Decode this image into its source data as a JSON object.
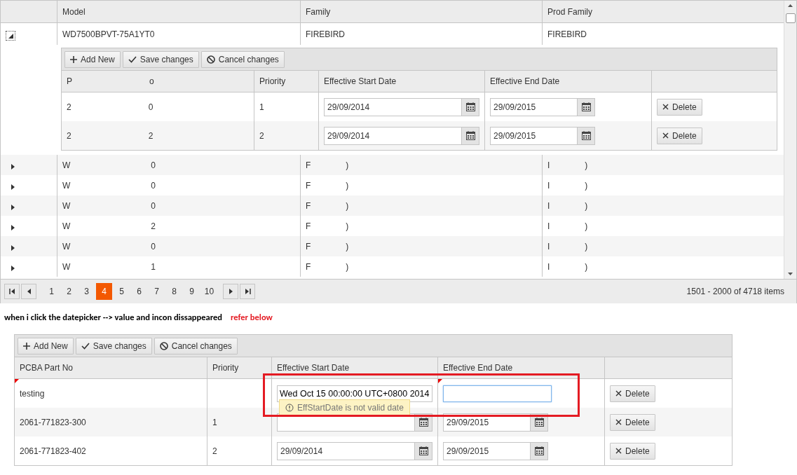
{
  "master_grid": {
    "columns": [
      {
        "label": "Model"
      },
      {
        "label": "Family"
      },
      {
        "label": "Prod Family"
      }
    ],
    "rows": [
      {
        "expanded": true,
        "cells": [
          {
            "kind": "text",
            "text": "WD7500BPVT-75A1YT0"
          },
          {
            "kind": "text",
            "text": "FIREBIRD"
          },
          {
            "kind": "text",
            "text": "FIREBIRD"
          }
        ],
        "detail": {
          "toolbar": [
            {
              "kind": "add",
              "label": "Add New"
            },
            {
              "kind": "save",
              "label": "Save changes"
            },
            {
              "kind": "cancel",
              "label": "Cancel changes"
            }
          ],
          "columns": [
            {
              "kind": "redacted",
              "start": "P",
              "end": "o"
            },
            {
              "kind": "text",
              "text": "Priority"
            },
            {
              "kind": "text",
              "text": "Effective Start Date"
            },
            {
              "kind": "text",
              "text": "Effective End Date"
            },
            {
              "kind": "empty"
            }
          ],
          "rows": [
            {
              "cells": [
                {
                  "kind": "redacted",
                  "start": "2",
                  "end": "0"
                },
                {
                  "kind": "text",
                  "text": "1"
                },
                {
                  "kind": "date",
                  "value": "29/09/2014"
                },
                {
                  "kind": "date",
                  "value": "29/09/2015"
                },
                {
                  "kind": "delete",
                  "label": "Delete"
                }
              ]
            },
            {
              "cells": [
                {
                  "kind": "redacted",
                  "start": "2",
                  "end": "2"
                },
                {
                  "kind": "text",
                  "text": "2"
                },
                {
                  "kind": "date",
                  "value": "29/09/2014"
                },
                {
                  "kind": "date",
                  "value": "29/09/2015"
                },
                {
                  "kind": "delete",
                  "label": "Delete"
                }
              ]
            }
          ]
        }
      },
      {
        "expanded": false,
        "cells": [
          {
            "kind": "redacted",
            "start": "W",
            "end": "0"
          },
          {
            "kind": "redacted",
            "start": "F",
            "end": ")"
          },
          {
            "kind": "redacted",
            "start": "I",
            "end": ")"
          }
        ]
      },
      {
        "expanded": false,
        "cells": [
          {
            "kind": "redacted",
            "start": "W",
            "end": "0"
          },
          {
            "kind": "redacted",
            "start": "F",
            "end": ")"
          },
          {
            "kind": "redacted",
            "start": "I",
            "end": ")"
          }
        ]
      },
      {
        "expanded": false,
        "cells": [
          {
            "kind": "redacted",
            "start": "W",
            "end": "0"
          },
          {
            "kind": "redacted",
            "start": "F",
            "end": ")"
          },
          {
            "kind": "redacted",
            "start": "I",
            "end": ")"
          }
        ]
      },
      {
        "expanded": false,
        "cells": [
          {
            "kind": "redacted",
            "start": "W",
            "end": "2"
          },
          {
            "kind": "redacted",
            "start": "F",
            "end": ")"
          },
          {
            "kind": "redacted",
            "start": "I",
            "end": ")"
          }
        ]
      },
      {
        "expanded": false,
        "cells": [
          {
            "kind": "redacted",
            "start": "W",
            "end": "0"
          },
          {
            "kind": "redacted",
            "start": "F",
            "end": ")"
          },
          {
            "kind": "redacted",
            "start": "I",
            "end": ")"
          }
        ]
      },
      {
        "expanded": false,
        "cells": [
          {
            "kind": "redacted",
            "start": "W",
            "end": "1"
          },
          {
            "kind": "redacted",
            "start": "F",
            "end": ")"
          },
          {
            "kind": "redacted",
            "start": "I",
            "end": ")"
          }
        ]
      }
    ],
    "pager": {
      "pages": [
        {
          "label": "1",
          "selected": false
        },
        {
          "label": "2",
          "selected": false
        },
        {
          "label": "3",
          "selected": false
        },
        {
          "label": "4",
          "selected": true
        },
        {
          "label": "5",
          "selected": false
        },
        {
          "label": "6",
          "selected": false
        },
        {
          "label": "7",
          "selected": false
        },
        {
          "label": "8",
          "selected": false
        },
        {
          "label": "9",
          "selected": false
        },
        {
          "label": "10",
          "selected": false
        }
      ],
      "info": "1501 - 2000 of 4718 items"
    }
  },
  "note": {
    "text": "when i click the datepicker --> value and incon dissappeared",
    "hint": "refer below"
  },
  "edit_grid": {
    "toolbar": [
      {
        "kind": "add",
        "label": "Add New"
      },
      {
        "kind": "save",
        "label": "Save changes"
      },
      {
        "kind": "cancel",
        "label": "Cancel changes"
      }
    ],
    "highlight": true,
    "columns": [
      {
        "kind": "text",
        "text": "PCBA Part No"
      },
      {
        "kind": "text",
        "text": "Priority"
      },
      {
        "kind": "text",
        "text": "Effective Start Date"
      },
      {
        "kind": "text",
        "text": "Effective End Date"
      },
      {
        "kind": "empty"
      }
    ],
    "rows": [
      {
        "cells": [
          {
            "kind": "text",
            "text": "testing",
            "dirty": true
          },
          {
            "kind": "empty"
          },
          {
            "kind": "editor",
            "value": "Wed Oct 15 00:00:00 UTC+0800 2014",
            "tooltip": "EffStartDate is not valid date"
          },
          {
            "kind": "editor",
            "dirty": true,
            "focused": true
          },
          {
            "kind": "delete",
            "label": "Delete"
          }
        ]
      },
      {
        "cells": [
          {
            "kind": "text",
            "text": "2061-771823-300"
          },
          {
            "kind": "text",
            "text": "1"
          },
          {
            "kind": "date"
          },
          {
            "kind": "date",
            "value": "29/09/2015"
          },
          {
            "kind": "delete",
            "label": "Delete"
          }
        ]
      },
      {
        "cells": [
          {
            "kind": "text",
            "text": "2061-771823-402"
          },
          {
            "kind": "text",
            "text": "2"
          },
          {
            "kind": "date",
            "value": "29/09/2014"
          },
          {
            "kind": "date",
            "value": "29/09/2015"
          },
          {
            "kind": "delete",
            "label": "Delete"
          }
        ]
      }
    ]
  }
}
